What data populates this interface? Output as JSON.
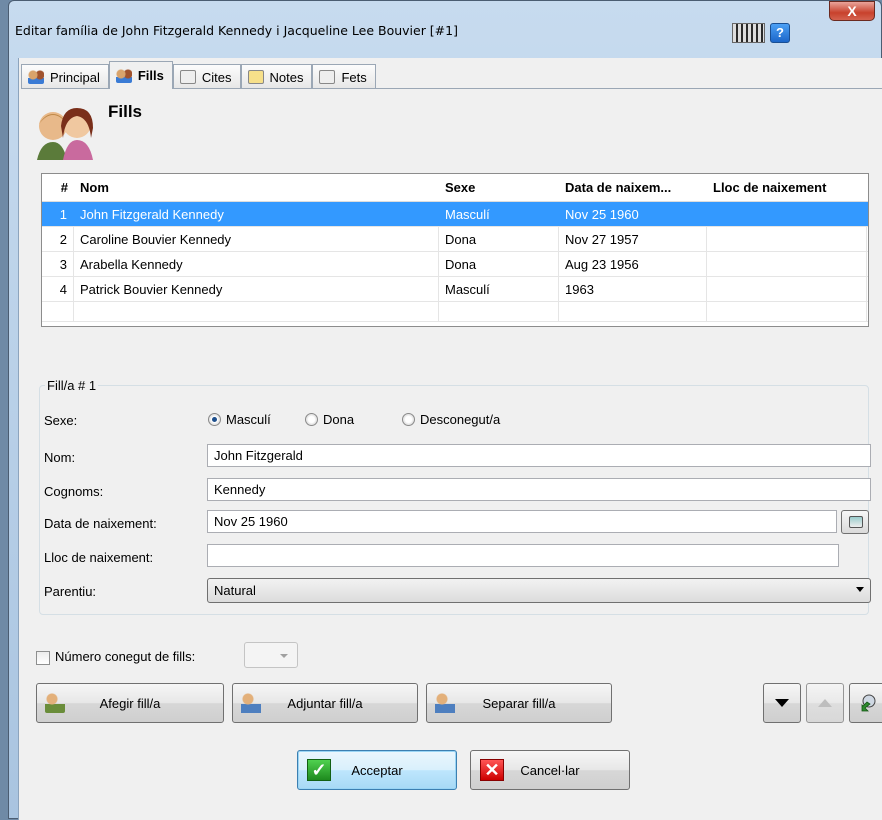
{
  "window": {
    "title": "Editar família de John Fitzgerald Kennedy i Jacqueline Lee Bouvier [#1]",
    "close_label": "X",
    "help_label": "?"
  },
  "tabs": [
    {
      "label": "Principal",
      "icon": "people-icon",
      "active": false
    },
    {
      "label": "Fills",
      "icon": "people-icon",
      "active": true
    },
    {
      "label": "Cites",
      "icon": "citation-icon",
      "active": false
    },
    {
      "label": "Notes",
      "icon": "note-icon",
      "active": false
    },
    {
      "label": "Fets",
      "icon": "event-icon",
      "active": false
    }
  ],
  "section": {
    "title": "Fills",
    "icon": "children-icon"
  },
  "grid": {
    "headers": [
      "#",
      "Nom",
      "Sexe",
      "Data de naixem...",
      "Lloc de naixement"
    ],
    "rows": [
      {
        "num": "1",
        "nom": "John Fitzgerald Kennedy",
        "sexe": "Masculí",
        "data": "Nov 25 1960",
        "lloc": "",
        "selected": true
      },
      {
        "num": "2",
        "nom": "Caroline Bouvier Kennedy",
        "sexe": "Dona",
        "data": "Nov 27 1957",
        "lloc": ""
      },
      {
        "num": "3",
        "nom": "Arabella Kennedy",
        "sexe": "Dona",
        "data": "Aug 23 1956",
        "lloc": ""
      },
      {
        "num": "4",
        "nom": "Patrick Bouvier Kennedy",
        "sexe": "Masculí",
        "data": "1963",
        "lloc": ""
      }
    ]
  },
  "form": {
    "group_label": "Fill/a # 1",
    "sexe_label": "Sexe:",
    "sexe_options": [
      "Masculí",
      "Dona",
      "Desconegut/a"
    ],
    "sexe_selected": "Masculí",
    "nom_label": "Nom:",
    "nom_value": "John Fitzgerald",
    "cognoms_label": "Cognoms:",
    "cognoms_value": "Kennedy",
    "data_label": "Data de naixement:",
    "data_value": "Nov 25 1960",
    "lloc_label": "Lloc de naixement:",
    "lloc_value": "",
    "parentiu_label": "Parentiu:",
    "parentiu_value": "Natural"
  },
  "known_children": {
    "label": "Número conegut de fills:",
    "checked": false,
    "value": ""
  },
  "buttons": {
    "add": "Afegir fill/a",
    "attach": "Adjuntar fill/a",
    "separate": "Separar fill/a",
    "accept": "Acceptar",
    "cancel": "Cancel·lar"
  },
  "colors": {
    "selection": "#3399ff",
    "accent": "#3c7fb1"
  }
}
